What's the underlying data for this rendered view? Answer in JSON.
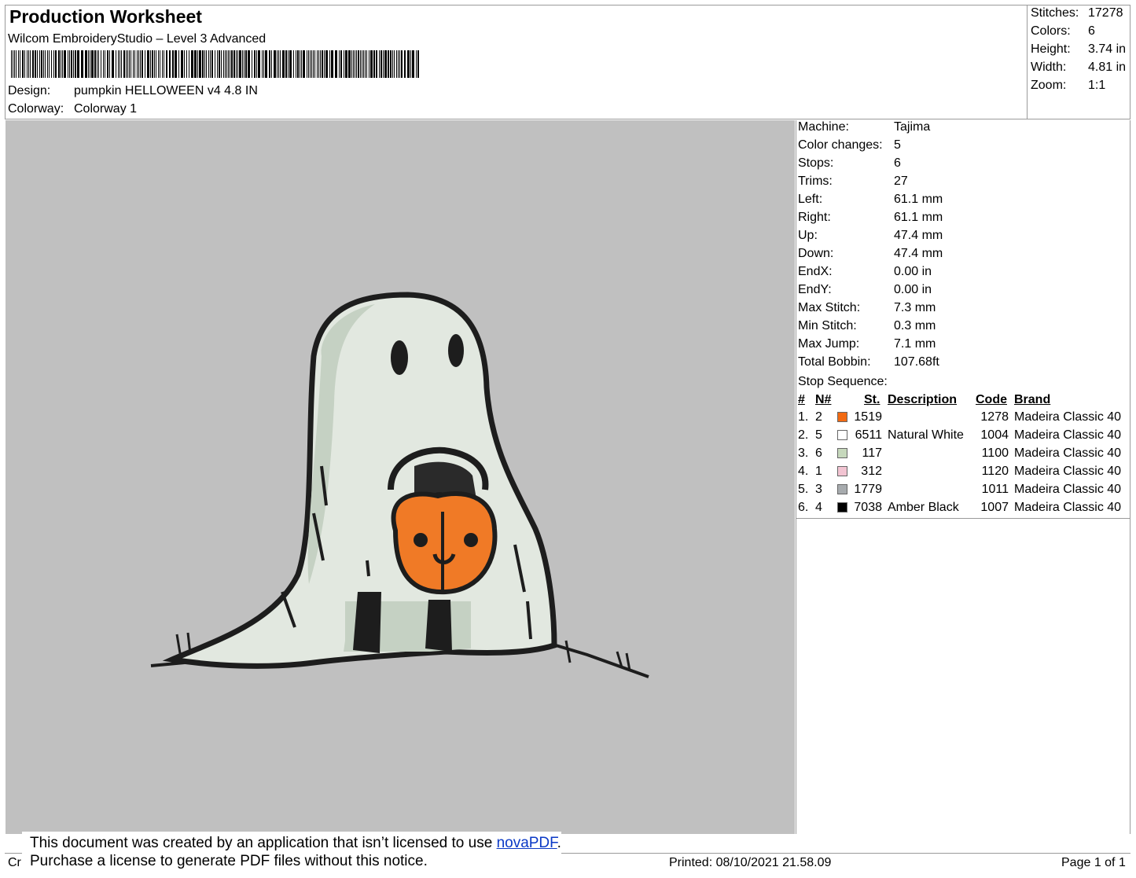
{
  "header": {
    "title": "Production Worksheet",
    "software": "Wilcom EmbroideryStudio – Level 3 Advanced",
    "design_label": "Design:",
    "design_value": "pumpkin HELLOWEEN v4 4.8 IN",
    "colorway_label": "Colorway:",
    "colorway_value": "Colorway 1"
  },
  "summary": [
    {
      "label": "Stitches:",
      "value": "17278"
    },
    {
      "label": "Colors:",
      "value": "6"
    },
    {
      "label": "Height:",
      "value": "3.74 in"
    },
    {
      "label": "Width:",
      "value": "4.81 in"
    },
    {
      "label": "Zoom:",
      "value": "1:1"
    }
  ],
  "info": [
    {
      "label": "Machine:",
      "value": "Tajima"
    },
    {
      "label": "Color changes:",
      "value": "5"
    },
    {
      "label": "Stops:",
      "value": "6"
    },
    {
      "label": "Trims:",
      "value": "27"
    },
    {
      "label": "Left:",
      "value": "61.1 mm"
    },
    {
      "label": "Right:",
      "value": "61.1 mm"
    },
    {
      "label": "Up:",
      "value": "47.4 mm"
    },
    {
      "label": "Down:",
      "value": "47.4 mm"
    },
    {
      "label": "EndX:",
      "value": "0.00 in"
    },
    {
      "label": "EndY:",
      "value": "0.00 in"
    },
    {
      "label": "Max Stitch:",
      "value": "7.3 mm"
    },
    {
      "label": "Min Stitch:",
      "value": "0.3 mm"
    },
    {
      "label": "Max Jump:",
      "value": "7.1 mm"
    },
    {
      "label": "Total Bobbin:",
      "value": "107.68ft"
    }
  ],
  "stop_sequence": {
    "heading": "Stop Sequence:",
    "columns": {
      "num": "#",
      "needle": "N#",
      "st": "St.",
      "description": "Description",
      "code": "Code",
      "brand": "Brand"
    },
    "rows": [
      {
        "num": "1.",
        "needle": "2",
        "color": "#f26a12",
        "st": "1519",
        "description": "",
        "code": "1278",
        "brand": "Madeira Classic 40"
      },
      {
        "num": "2.",
        "needle": "5",
        "color": "#ffffff",
        "st": "6511",
        "description": "Natural White",
        "code": "1004",
        "brand": "Madeira Classic 40"
      },
      {
        "num": "3.",
        "needle": "6",
        "color": "#c6d8bc",
        "st": "117",
        "description": "",
        "code": "1100",
        "brand": "Madeira Classic 40"
      },
      {
        "num": "4.",
        "needle": "1",
        "color": "#f2c4d2",
        "st": "312",
        "description": "",
        "code": "1120",
        "brand": "Madeira Classic 40"
      },
      {
        "num": "5.",
        "needle": "3",
        "color": "#a7abae",
        "st": "1779",
        "description": "",
        "code": "1011",
        "brand": "Madeira Classic 40"
      },
      {
        "num": "6.",
        "needle": "4",
        "color": "#000000",
        "st": "7038",
        "description": "Amber Black",
        "code": "1007",
        "brand": "Madeira Classic 40"
      }
    ]
  },
  "footer": {
    "left_text": "Cr",
    "printed": "Printed: 08/10/2021 21.58.09",
    "page": "Page 1 of 1"
  },
  "notice": {
    "line1_prefix": "This document was created by an application that isn’t licensed to use ",
    "link": "novaPDF",
    "line1_suffix": ".",
    "line2": "Purchase a license to generate PDF files without this notice."
  },
  "colors": {
    "preview_bg": "#c0c0c0",
    "ghost_fill": "#e2e8e0",
    "ghost_shade": "#c5d1c3",
    "pumpkin": "#f07a26",
    "outline": "#1d1d1d"
  }
}
